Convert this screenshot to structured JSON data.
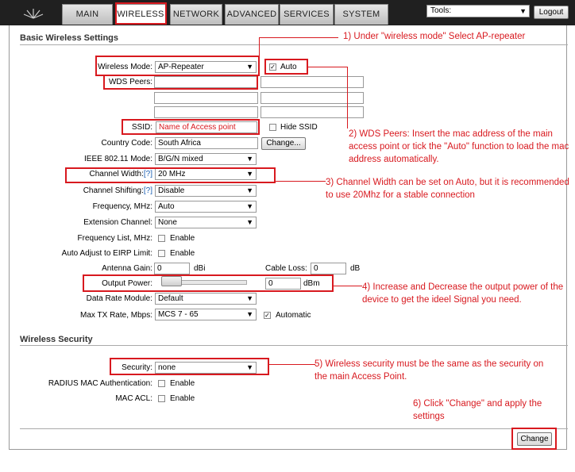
{
  "topbar": {
    "tabs": [
      "MAIN",
      "WIRELESS",
      "NETWORK",
      "ADVANCED",
      "SERVICES",
      "SYSTEM"
    ],
    "active_tab": "WIRELESS",
    "tools_label": "Tools:",
    "logout_label": "Logout"
  },
  "basic": {
    "title": "Basic Wireless Settings",
    "wireless_mode_label": "Wireless Mode:",
    "wireless_mode_value": "AP-Repeater",
    "auto_label": "Auto",
    "wds_label": "WDS Peers:",
    "ssid_label": "SSID:",
    "ssid_value": "Name of Access point",
    "hide_ssid_label": "Hide SSID",
    "country_label": "Country Code:",
    "country_value": "South Africa",
    "change_country_label": "Change...",
    "ieee_label": "IEEE 802.11 Mode:",
    "ieee_value": "B/G/N mixed",
    "channel_width_label": "Channel Width:",
    "channel_width_value": "20 MHz",
    "channel_shifting_label": "Channel Shifting:",
    "channel_shifting_value": "Disable",
    "help_mark": "[?]",
    "frequency_label": "Frequency, MHz:",
    "frequency_value": "Auto",
    "extension_label": "Extension Channel:",
    "extension_value": "None",
    "freq_list_label": "Frequency List, MHz:",
    "enable_label": "Enable",
    "eirp_label": "Auto Adjust to EIRP Limit:",
    "antenna_gain_label": "Antenna Gain:",
    "antenna_gain_value": "0",
    "dbi_unit": "dBi",
    "cable_loss_label": "Cable Loss:",
    "cable_loss_value": "0",
    "db_unit": "dB",
    "output_power_label": "Output Power:",
    "output_power_value": "0",
    "dbm_unit": "dBm",
    "data_rate_label": "Data Rate Module:",
    "data_rate_value": "Default",
    "max_tx_label": "Max TX Rate, Mbps:",
    "max_tx_value": "MCS 7 - 65",
    "automatic_label": "Automatic"
  },
  "security": {
    "title": "Wireless Security",
    "security_label": "Security:",
    "security_value": "none",
    "radius_label": "RADIUS MAC Authentication:",
    "mac_acl_label": "MAC ACL:",
    "enable_label": "Enable"
  },
  "change_button_label": "Change",
  "annotations": {
    "a1": "1) Under \"wireless mode\" Select AP-repeater",
    "a2": "2) WDS Peers: Insert the mac address of the main access point or tick the \"Auto\" function to load the mac address automatically.",
    "a3": "3) Channel Width can be set on Auto, but it is recommended to use 20Mhz for a stable connection",
    "a4": "4) Increase and Decrease the output power of the device to get the ideel Signal you need.",
    "a5": "5) Wireless security must be the same as the security on the main Access Point.",
    "a6": "6) Click \"Change\" and apply the settings"
  },
  "colors": {
    "annotation_red": "#d8191f",
    "topbar": "#202020",
    "help_link": "#1a5fb4"
  }
}
